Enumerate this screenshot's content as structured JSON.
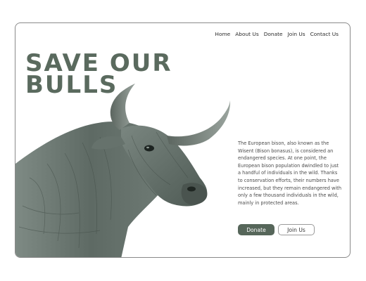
{
  "nav": {
    "items": [
      {
        "label": "Home"
      },
      {
        "label": "About Us"
      },
      {
        "label": "Donate"
      },
      {
        "label": "Join Us"
      },
      {
        "label": "Contact Us"
      }
    ]
  },
  "hero": {
    "headline_line1": "SAVE OUR",
    "headline_line2": "BULLS",
    "description": "The European bison, also known as the Wisent (Bison bonasus), is considered an endangered species. At one point, the European bison population dwindled to just a handful of individuals in the wild. Thanks to conservation efforts, their numbers have increased, but they remain endangered with only a few thousand individuals in the wild, mainly in protected areas.",
    "donate_label": "Donate",
    "join_label": "Join Us"
  },
  "colors": {
    "accent": "#56665a",
    "headline": "#5a6a5e"
  },
  "image": {
    "subject": "bull-photo"
  }
}
